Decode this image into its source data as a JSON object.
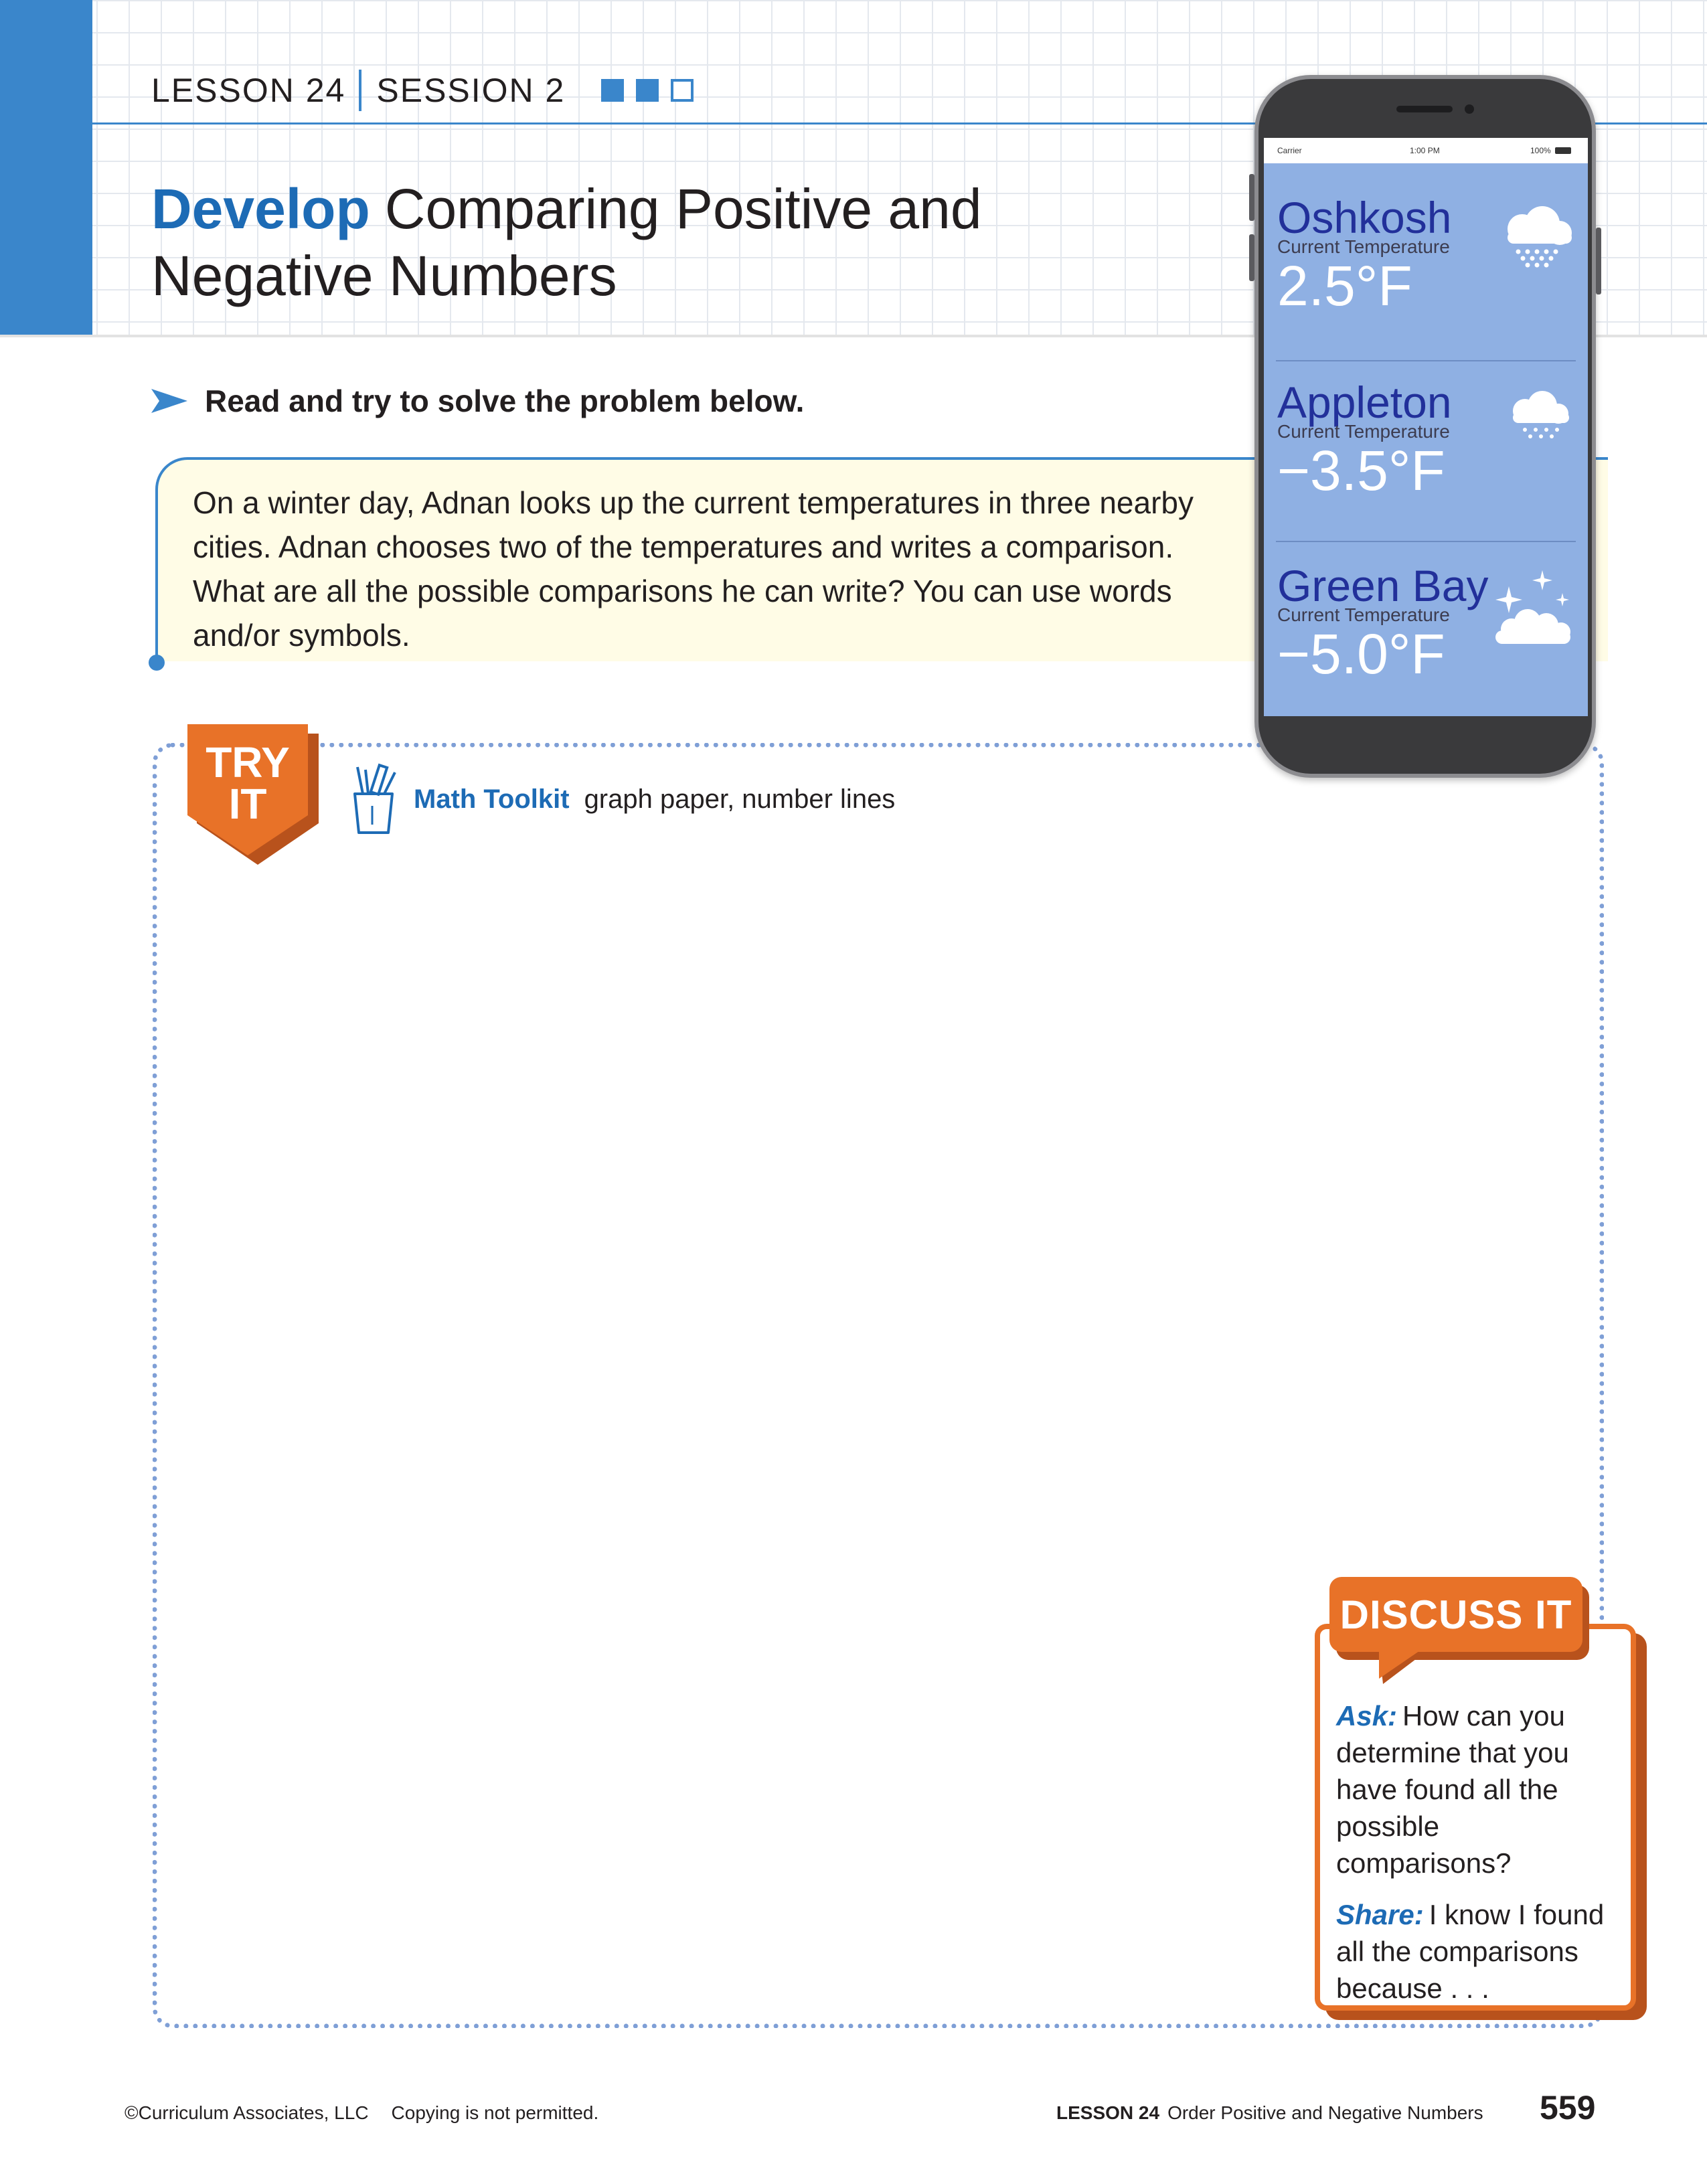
{
  "header": {
    "lesson": "LESSON 24",
    "session": "SESSION 2",
    "progress": {
      "filled": 2,
      "total": 3
    },
    "title_keyword": "Develop",
    "title_line1": "Comparing Positive and",
    "title_line2": "Negative Numbers"
  },
  "instruction": "Read and try to solve the problem below.",
  "problem": {
    "text": "On a winter day, Adnan looks up the current temperatures in three nearby cities. Adnan chooses two of the temperatures and writes a comparison. What are all the possible comparisons he can write? You can use words and/or symbols."
  },
  "phone": {
    "status": {
      "carrier": "Carrier",
      "time": "1:00 PM",
      "battery": "100%"
    },
    "cities": [
      {
        "name": "Oshkosh",
        "label": "Current Temperature",
        "temp": "2.5°F",
        "icon": "snow-cloud-icon"
      },
      {
        "name": "Appleton",
        "label": "Current Temperature",
        "temp": "−3.5°F",
        "icon": "snow-cloud-icon"
      },
      {
        "name": "Green Bay",
        "label": "Current Temperature",
        "temp": "−5.0°F",
        "icon": "sparkle-cloud-icon"
      }
    ]
  },
  "try_it": {
    "badge_line1": "TRY",
    "badge_line2": "IT",
    "toolkit_label": "Math Toolkit",
    "toolkit_items": "graph paper, number lines"
  },
  "discuss_it": {
    "title": "DISCUSS IT",
    "ask_label": "Ask:",
    "ask_text": "How can you determine that you have found all the possible comparisons?",
    "share_label": "Share:",
    "share_text": "I know I found all the comparisons because . . ."
  },
  "footer": {
    "copyright": "©Curriculum Associates, LLC",
    "copy_notice": "Copying is not permitted.",
    "lesson": "LESSON 24",
    "lesson_title": "Order Positive and Negative Numbers",
    "page_number": "559"
  },
  "colors": {
    "brand_blue": "#3a86cb",
    "title_blue": "#1d6bb5",
    "accent_orange": "#e87228",
    "problem_background": "#fffce6",
    "phone_screen": "#8fb0e3"
  }
}
